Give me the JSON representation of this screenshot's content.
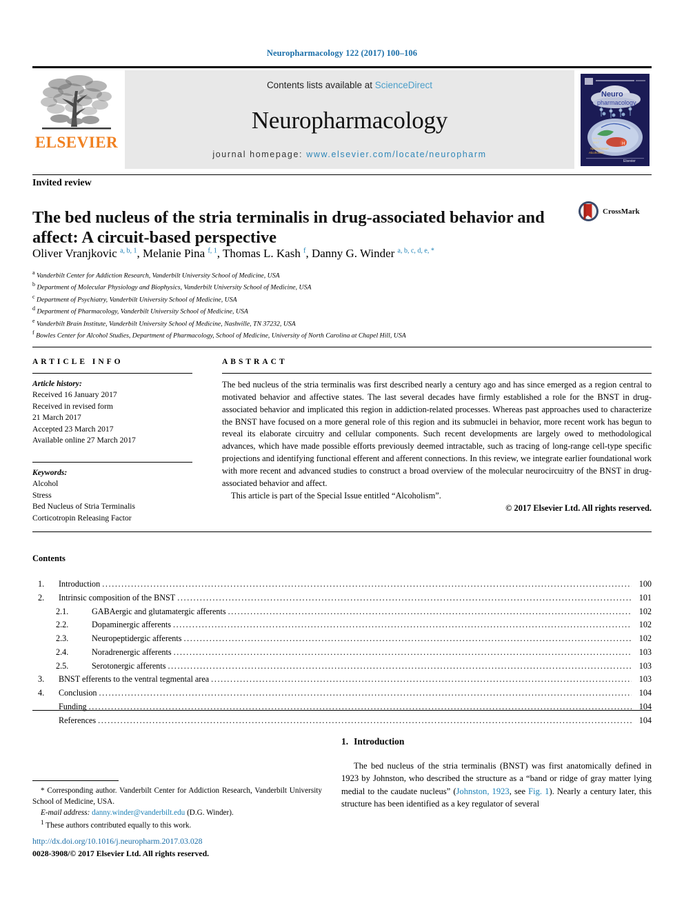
{
  "running_head": "Neuropharmacology 122 (2017) 100–106",
  "masthead": {
    "publisher_logo_text": "ELSEVIER",
    "contents_prefix": "Contents lists available at ",
    "contents_link": "ScienceDirect",
    "journal_name": "Neuropharmacology",
    "homepage_prefix": "journal homepage: ",
    "homepage_url": "www.elsevier.com/locate/neuropharm",
    "cover_alt": "Neuropharmacology journal cover"
  },
  "article": {
    "type_label": "Invited review",
    "title": "The bed nucleus of the stria terminalis in drug-associated behavior and affect: A circuit-based perspective",
    "crossmark_label": "CrossMark",
    "authors_html": "Oliver Vranjkovic <sup>a, b, 1</sup>, Melanie Pina <sup>f, 1</sup>, Thomas L. Kash <sup>f</sup>, Danny G. Winder <sup>a, b, c, d, e, *</sup>",
    "affiliations": [
      {
        "marker": "a",
        "text": "Vanderbilt Center for Addiction Research, Vanderbilt University School of Medicine, USA"
      },
      {
        "marker": "b",
        "text": "Department of Molecular Physiology and Biophysics, Vanderbilt University School of Medicine, USA"
      },
      {
        "marker": "c",
        "text": "Department of Psychiatry, Vanderbilt University School of Medicine, USA"
      },
      {
        "marker": "d",
        "text": "Department of Pharmacology, Vanderbilt University School of Medicine, USA"
      },
      {
        "marker": "e",
        "text": "Vanderbilt Brain Institute, Vanderbilt University School of Medicine, Nashville, TN 37232, USA"
      },
      {
        "marker": "f",
        "text": "Bowles Center for Alcohol Studies, Department of Pharmacology, School of Medicine, University of North Carolina at Chapel Hill, USA"
      }
    ]
  },
  "article_info": {
    "heading": "ARTICLE INFO",
    "history_label": "Article history:",
    "history": [
      "Received 16 January 2017",
      "Received in revised form",
      "21 March 2017",
      "Accepted 23 March 2017",
      "Available online 27 March 2017"
    ],
    "keywords_label": "Keywords:",
    "keywords": [
      "Alcohol",
      "Stress",
      "Bed Nucleus of Stria Terminalis",
      "Corticotropin Releasing Factor"
    ]
  },
  "abstract": {
    "heading": "ABSTRACT",
    "paragraph1": "The bed nucleus of the stria terminalis was first described nearly a century ago and has since emerged as a region central to motivated behavior and affective states. The last several decades have firmly established a role for the BNST in drug-associated behavior and implicated this region in addiction-related processes. Whereas past approaches used to characterize the BNST have focused on a more general role of this region and its submuclei in behavior, more recent work has begun to reveal its elaborate circuitry and cellular components. Such recent developments are largely owed to methodological advances, which have made possible efforts previously deemed intractable, such as tracing of long-range cell-type specific projections and identifying functional efferent and afferent connections. In this review, we integrate earlier foundational work with more recent and advanced studies to construct a broad overview of the molecular neurocircuitry of the BNST in drug-associated behavior and affect.",
    "paragraph2": "This article is part of the Special Issue entitled “Alcoholism”.",
    "copyright": "© 2017 Elsevier Ltd. All rights reserved."
  },
  "contents": {
    "heading": "Contents",
    "entries": [
      {
        "number": "1.",
        "label": "Introduction",
        "page": "100",
        "sub": false
      },
      {
        "number": "2.",
        "label": "Intrinsic composition of the BNST",
        "page": "101",
        "sub": false
      },
      {
        "number": "2.1.",
        "label": "GABAergic and glutamatergic afferents",
        "page": "102",
        "sub": true
      },
      {
        "number": "2.2.",
        "label": "Dopaminergic afferents",
        "page": "102",
        "sub": true
      },
      {
        "number": "2.3.",
        "label": "Neuropeptidergic afferents",
        "page": "102",
        "sub": true
      },
      {
        "number": "2.4.",
        "label": "Noradrenergic afferents",
        "page": "103",
        "sub": true
      },
      {
        "number": "2.5.",
        "label": "Serotonergic afferents",
        "page": "103",
        "sub": true
      },
      {
        "number": "3.",
        "label": "BNST efferents to the ventral tegmental area",
        "page": "103",
        "sub": false
      },
      {
        "number": "4.",
        "label": "Conclusion",
        "page": "104",
        "sub": false
      },
      {
        "number": "",
        "label": "Funding",
        "page": "104",
        "sub": false
      },
      {
        "number": "",
        "label": "References",
        "page": "104",
        "sub": false
      }
    ]
  },
  "introduction": {
    "number": "1.",
    "heading": "Introduction",
    "text_part1": "The bed nucleus of the stria terminalis (BNST) was first anatomically defined in 1923 by Johnston, who described the structure as a “band or ridge of gray matter lying medial to the caudate nucleus” (",
    "citation1": "Johnston, 1923",
    "text_part2": ", see ",
    "citation2": "Fig. 1",
    "text_part3": "). Nearly a century later, this structure has been identified as a key regulator of several"
  },
  "footnotes": {
    "corresponding_marker": "*",
    "corresponding_text": "Corresponding author. Vanderbilt Center for Addiction Research, Vanderbilt University School of Medicine, USA.",
    "email_label": "E-mail address:",
    "email": "danny.winder@vanderbilt.edu",
    "email_suffix": "(D.G. Winder).",
    "equal_marker": "1",
    "equal_text": "These authors contributed equally to this work."
  },
  "doi_block": {
    "doi_url": "http://dx.doi.org/10.1016/j.neuropharm.2017.03.028",
    "issn_line": "0028-3908/© 2017 Elsevier Ltd. All rights reserved."
  },
  "colors": {
    "link_blue": "#1a7fb5",
    "elsevier_orange": "#f08020",
    "sciencedirect_blue": "#4a9ec9",
    "cover_navy": "#1b1b55",
    "crossmark_red": "#c0281e"
  }
}
